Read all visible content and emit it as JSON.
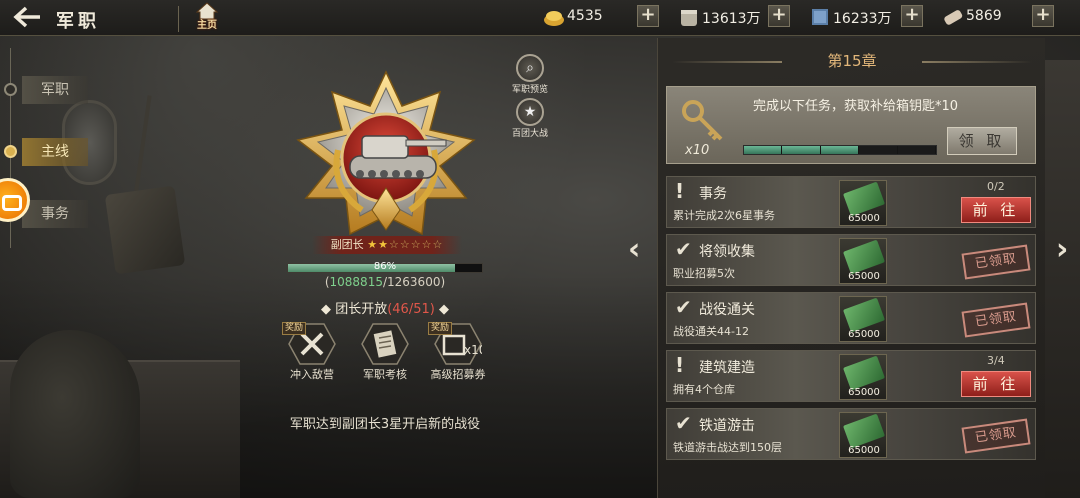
{
  "header": {
    "title": "军职",
    "home_label": "主页"
  },
  "resources": [
    {
      "icon": "gold-icon",
      "value": "4535"
    },
    {
      "icon": "coin-stack-icon",
      "value": "13613万"
    },
    {
      "icon": "book-icon",
      "value": "16233万"
    },
    {
      "icon": "scroll-icon",
      "value": "5869"
    }
  ],
  "side_tabs": [
    {
      "label": "军职",
      "active": false
    },
    {
      "label": "主线",
      "active": true
    },
    {
      "label": "事务",
      "active": false
    }
  ],
  "center": {
    "rank_label": "副团长",
    "stars_filled": 2,
    "stars_total": 7,
    "progress_percent": 86,
    "progress_text": "86%",
    "exp_current": "1088815",
    "exp_total": "1263600",
    "unlock_label": "团长开放",
    "unlock_count": "(46/51)",
    "rewards": [
      {
        "tag": "奖励",
        "label": "冲入敌营"
      },
      {
        "tag": "",
        "label": "军职考核"
      },
      {
        "tag": "奖励",
        "label": "高级招募券"
      }
    ],
    "hint": "军职达到副团长3星开启新的战役",
    "mini_buttons": [
      {
        "label": "军职预览"
      },
      {
        "label": "百团大战"
      }
    ]
  },
  "panel": {
    "chapter": "第15章",
    "reward_text": "完成以下任务，获取补给箱钥匙*10",
    "key_qty": "x10",
    "segments_on": 3,
    "segments_total": 5,
    "claim_label": "领 取",
    "tasks": [
      {
        "icon": "exclamation",
        "name": "事务",
        "desc": "累计完成2次6星事务",
        "reward": "65000",
        "progress": "0/2",
        "status": "go",
        "button": "前 往"
      },
      {
        "icon": "check",
        "name": "将领收集",
        "desc": "职业招募5次",
        "reward": "65000",
        "progress": "",
        "status": "done",
        "button": "已领取"
      },
      {
        "icon": "check",
        "name": "战役通关",
        "desc": "战役通关44-12",
        "reward": "65000",
        "progress": "",
        "status": "done",
        "button": "已领取"
      },
      {
        "icon": "exclamation",
        "name": "建筑建造",
        "desc": "拥有4个仓库",
        "reward": "65000",
        "progress": "3/4",
        "status": "go",
        "button": "前 往"
      },
      {
        "icon": "check",
        "name": "铁道游击",
        "desc": "铁道游击战达到150层",
        "reward": "65000",
        "progress": "",
        "status": "done",
        "button": "已领取"
      }
    ]
  },
  "colors": {
    "accent_gold": "#e3b77a",
    "go_red": "#c2362f",
    "progress_green": "#4f8b69"
  }
}
